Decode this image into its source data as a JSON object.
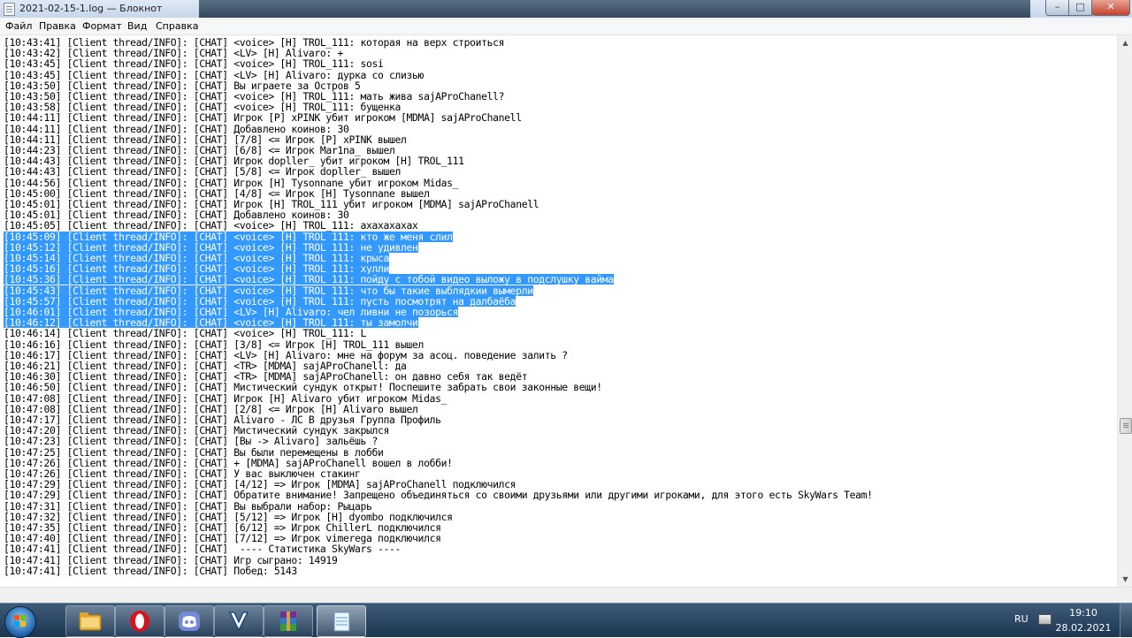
{
  "window": {
    "title": "2021-02-15-1.log — Блокнот",
    "minimize_label": "–",
    "maximize_label": "□",
    "close_label": "✕"
  },
  "menu": [
    "Файл",
    "Правка",
    "Формат",
    "Вид",
    "Справка"
  ],
  "editor": {
    "lines": [
      "[10:43:41] [Client thread/INFO]: [CHAT] <voice> [H] TROL_111: которая на верх строиться",
      "[10:43:42] [Client thread/INFO]: [CHAT] <LV> [H] Alivaro: +",
      "[10:43:45] [Client thread/INFO]: [CHAT] <voice> [H] TROL_111: sosi",
      "[10:43:45] [Client thread/INFO]: [CHAT] <LV> [H] Alivaro: дурка со слизью",
      "[10:43:50] [Client thread/INFO]: [CHAT] Вы играете за Остров 5",
      "[10:43:50] [Client thread/INFO]: [CHAT] <voice> [H] TROL_111: мать жива sajAProChanell?",
      "[10:43:58] [Client thread/INFO]: [CHAT] <voice> [H] TROL_111: бущенка",
      "[10:44:11] [Client thread/INFO]: [CHAT] Игрок [P] xPINK убит игроком [MDMA] sajAProChanell",
      "[10:44:11] [Client thread/INFO]: [CHAT] Добавлено коинов: 30",
      "[10:44:11] [Client thread/INFO]: [CHAT] [7/8] <= Игрок [P] xPINK вышел",
      "[10:44:23] [Client thread/INFO]: [CHAT] [6/8] <= Игрок Mar1na_ вышел",
      "[10:44:43] [Client thread/INFO]: [CHAT] Игрок dopller_ убит игроком [H] TROL_111",
      "[10:44:43] [Client thread/INFO]: [CHAT] [5/8] <= Игрок dopller_ вышел",
      "[10:44:56] [Client thread/INFO]: [CHAT] Игрок [H] Tysonnane убит игроком Midas_",
      "[10:45:00] [Client thread/INFO]: [CHAT] [4/8] <= Игрок [H] Tysonnane вышел",
      "[10:45:01] [Client thread/INFO]: [CHAT] Игрок [H] TROL_111 убит игроком [MDMA] sajAProChanell",
      "[10:45:01] [Client thread/INFO]: [CHAT] Добавлено коинов: 30",
      "[10:45:05] [Client thread/INFO]: [CHAT] <voice> [H] TROL_111: ахахахахах",
      "[10:45:09] [Client thread/INFO]: [CHAT] <voice> [H] TROL_111: кто же меня слил",
      "[10:45:12] [Client thread/INFO]: [CHAT] <voice> [H] TROL_111: не удивлен",
      "[10:45:14] [Client thread/INFO]: [CHAT] <voice> [H] TROL_111: крыса",
      "[10:45:16] [Client thread/INFO]: [CHAT] <voice> [H] TROL_111: хулли",
      "[10:45:36] [Client thread/INFO]: [CHAT] <voice> [H] TROL_111: пойду с тобой видео выложу в подслушку вайма",
      "[10:45:43] [Client thread/INFO]: [CHAT] <voice> [H] TROL_111: что бы такие выблядкии вымерли",
      "[10:45:57] [Client thread/INFO]: [CHAT] <voice> [H] TROL_111: пусть посмотрят на далбаёба",
      "[10:46:01] [Client thread/INFO]: [CHAT] <LV> [H] Alivaro: чел ливни не позорься",
      "[10:46:12] [Client thread/INFO]: [CHAT] <voice> [H] TROL_111: ты замолчи",
      "[10:46:14] [Client thread/INFO]: [CHAT] <voice> [H] TROL_111: L",
      "[10:46:16] [Client thread/INFO]: [CHAT] [3/8] <= Игрок [H] TROL_111 вышел",
      "[10:46:17] [Client thread/INFO]: [CHAT] <LV> [H] Alivaro: мне на форум за асоц. поведение залить ?",
      "[10:46:21] [Client thread/INFO]: [CHAT] <TR> [MDMA] sajAProChanell: да",
      "[10:46:30] [Client thread/INFO]: [CHAT] <TR> [MDMA] sajAProChanell: он давно себя так ведёт",
      "[10:46:50] [Client thread/INFO]: [CHAT] Мистический сундук открыт! Поспешите забрать свои законные вещи!",
      "[10:47:08] [Client thread/INFO]: [CHAT] Игрок [H] Alivaro убит игроком Midas_",
      "[10:47:08] [Client thread/INFO]: [CHAT] [2/8] <= Игрок [H] Alivaro вышел",
      "[10:47:17] [Client thread/INFO]: [CHAT] Alivaro - ЛС В друзья Группа Профиль",
      "[10:47:20] [Client thread/INFO]: [CHAT] Мистический сундук закрылся",
      "[10:47:23] [Client thread/INFO]: [CHAT] [Вы -> Alivaro] зальёшь ?",
      "[10:47:25] [Client thread/INFO]: [CHAT] Вы были перемещены в лобби",
      "[10:47:26] [Client thread/INFO]: [CHAT] + [MDMA] sajAProChanell вошел в лобби!",
      "[10:47:26] [Client thread/INFO]: [CHAT] У вас выключен стакинг",
      "[10:47:29] [Client thread/INFO]: [CHAT] [4/12] => Игрок [MDMA] sajAProChanell подключился",
      "[10:47:29] [Client thread/INFO]: [CHAT] Обратите внимание! Запрещено объединяться со своими друзьями или другими игроками, для этого есть SkyWars Team!",
      "[10:47:31] [Client thread/INFO]: [CHAT] Вы выбрали набор: Рыцарь",
      "[10:47:32] [Client thread/INFO]: [CHAT] [5/12] => Игрок [H] dyombo подключился",
      "[10:47:35] [Client thread/INFO]: [CHAT] [6/12] => Игрок ChillerL подключился",
      "[10:47:40] [Client thread/INFO]: [CHAT] [7/12] => Игрок vimerega подключился",
      "[10:47:41] [Client thread/INFO]: [CHAT]  ---- Статистика SkyWars ----",
      "[10:47:41] [Client thread/INFO]: [CHAT] Игр сыграно: 14919",
      "[10:47:41] [Client thread/INFO]: [CHAT] Побед: 5143"
    ],
    "selected_range": [
      18,
      26
    ]
  },
  "scrollbar": {
    "up_arrow": "▲",
    "down_arrow": "▼"
  },
  "taskbar": {
    "apps": [
      {
        "name": "explorer-icon",
        "state": "open"
      },
      {
        "name": "opera-icon",
        "state": "open"
      },
      {
        "name": "discord-icon",
        "state": "open"
      },
      {
        "name": "vimeworld-icon",
        "state": "open"
      },
      {
        "name": "winrar-icon",
        "state": "open"
      },
      {
        "name": "notepad-icon",
        "state": "active"
      }
    ],
    "language": "RU",
    "time": "19:10",
    "date": "28.02.2021"
  },
  "colors": {
    "selection": "#3399ff",
    "taskbar": "#2a4563"
  }
}
